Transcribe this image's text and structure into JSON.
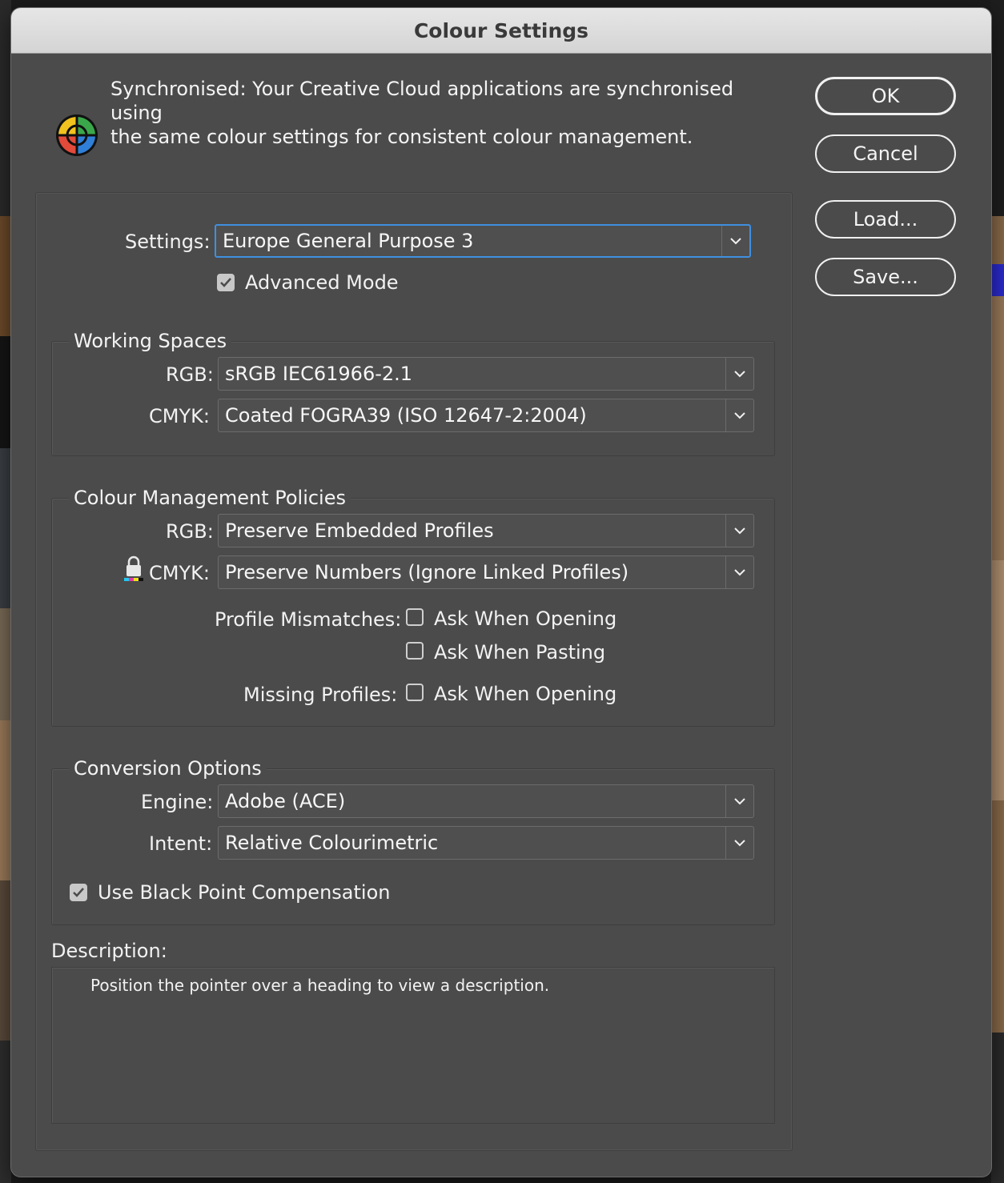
{
  "window": {
    "title": "Colour Settings"
  },
  "sync": {
    "line1": "Synchronised: Your Creative Cloud applications are synchronised using",
    "line2": "the same colour settings for consistent colour management.",
    "icon": "colour-wheel-icon"
  },
  "buttons": {
    "ok": "OK",
    "cancel": "Cancel",
    "load": "Load...",
    "save": "Save..."
  },
  "settings": {
    "label": "Settings:",
    "value": "Europe General Purpose 3",
    "advanced_mode_label": "Advanced Mode",
    "advanced_mode_checked": true
  },
  "working_spaces": {
    "title": "Working Spaces",
    "rgb_label": "RGB:",
    "rgb_value": "sRGB IEC61966-2.1",
    "cmyk_label": "CMYK:",
    "cmyk_value": "Coated FOGRA39 (ISO 12647-2:2004)"
  },
  "policies": {
    "title": "Colour Management Policies",
    "rgb_label": "RGB:",
    "rgb_value": "Preserve Embedded Profiles",
    "cmyk_label": "CMYK:",
    "cmyk_value": "Preserve Numbers (Ignore Linked Profiles)",
    "profile_mismatches_label": "Profile Mismatches:",
    "ask_when_opening_label": "Ask When Opening",
    "ask_when_pasting_label": "Ask When Pasting",
    "missing_profiles_label": "Missing Profiles:",
    "missing_ask_when_opening_label": "Ask When Opening"
  },
  "conversion": {
    "title": "Conversion Options",
    "engine_label": "Engine:",
    "engine_value": "Adobe (ACE)",
    "intent_label": "Intent:",
    "intent_value": "Relative Colourimetric",
    "black_point_label": "Use Black Point Compensation",
    "black_point_checked": true
  },
  "description": {
    "title": "Description:",
    "text": "Position the pointer over a heading to view a description."
  },
  "colors": {
    "dialog_bg": "#4b4b4b",
    "titlebar_bg": "#d8d8d8",
    "focus_border": "#3f8fe0"
  }
}
